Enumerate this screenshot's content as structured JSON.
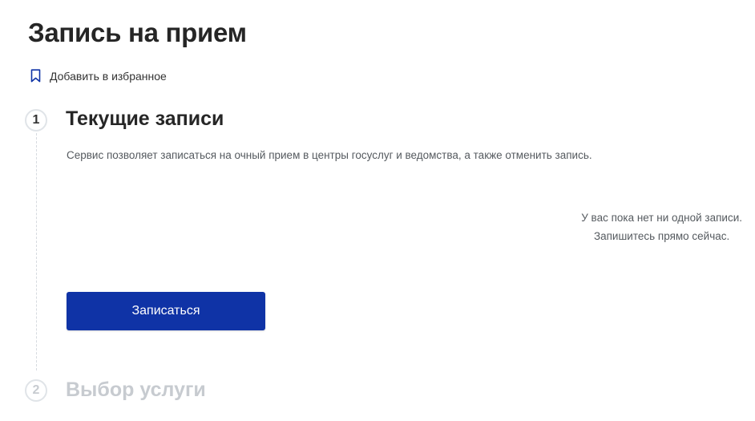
{
  "page": {
    "title": "Запись на прием"
  },
  "favorite": {
    "label": "Добавить в избранное",
    "icon": "bookmark-icon"
  },
  "steps": [
    {
      "number": "1",
      "title": "Текущие записи",
      "state": "active"
    },
    {
      "number": "2",
      "title": "Выбор услуги",
      "state": "inactive"
    }
  ],
  "step1": {
    "description": "Сервис позволяет записаться на очный прием в центры госуслуг и ведомства, а также отменить запись.",
    "empty_state": {
      "line1": "У вас пока нет ни одной записи.",
      "line2": "Запишитесь прямо сейчас."
    },
    "button_label": "Записаться"
  },
  "colors": {
    "primary": "#0f33a6",
    "text": "#262626",
    "muted": "#c7cbd0"
  }
}
